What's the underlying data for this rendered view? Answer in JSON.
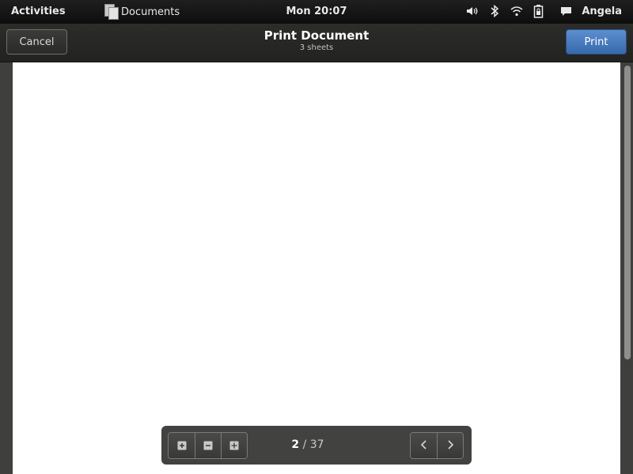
{
  "topbar": {
    "activities": "Activities",
    "app_name": "Documents",
    "app_icon": "documents-icon",
    "clock": "Mon 20:07",
    "tray_icons": [
      "volume-icon",
      "bluetooth-icon",
      "wifi-icon",
      "battery-lock-icon"
    ],
    "user_icon": "chat-bubble-icon",
    "user_name": "Angela"
  },
  "dialog": {
    "cancel_label": "Cancel",
    "title": "Print Document",
    "subtitle": "3 sheets",
    "print_label": "Print",
    "print_color": "#4a7fc4"
  },
  "preview": {
    "page_background": "#ffffff",
    "scroll_position": 0
  },
  "toolbar": {
    "zoom_buttons": [
      "zoom-in-icon",
      "zoom-out-icon",
      "zoom-fit-icon"
    ],
    "current_page": "2",
    "separator": " / ",
    "total_pages": "37",
    "nav_buttons": [
      "previous-page-icon",
      "next-page-icon"
    ]
  }
}
